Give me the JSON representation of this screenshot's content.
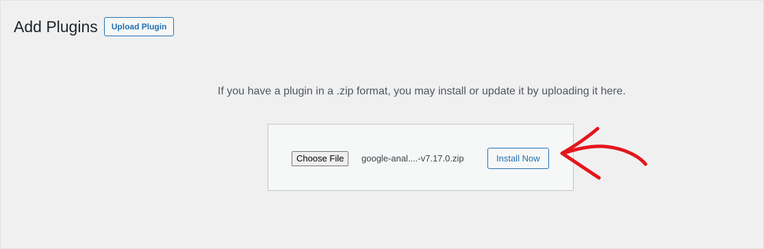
{
  "header": {
    "title": "Add Plugins",
    "upload_button_label": "Upload Plugin"
  },
  "upload": {
    "help_text": "If you have a plugin in a .zip format, you may install or update it by uploading it here.",
    "choose_file_label": "Choose File",
    "file_name": "google-anal....-v7.17.0.zip",
    "install_button_label": "Install Now"
  },
  "colors": {
    "accent": "#2271b1",
    "background": "#f0f0f1",
    "annotation_arrow": "#e3161b"
  },
  "icons": {
    "annotation": "red-arrow-icon"
  }
}
